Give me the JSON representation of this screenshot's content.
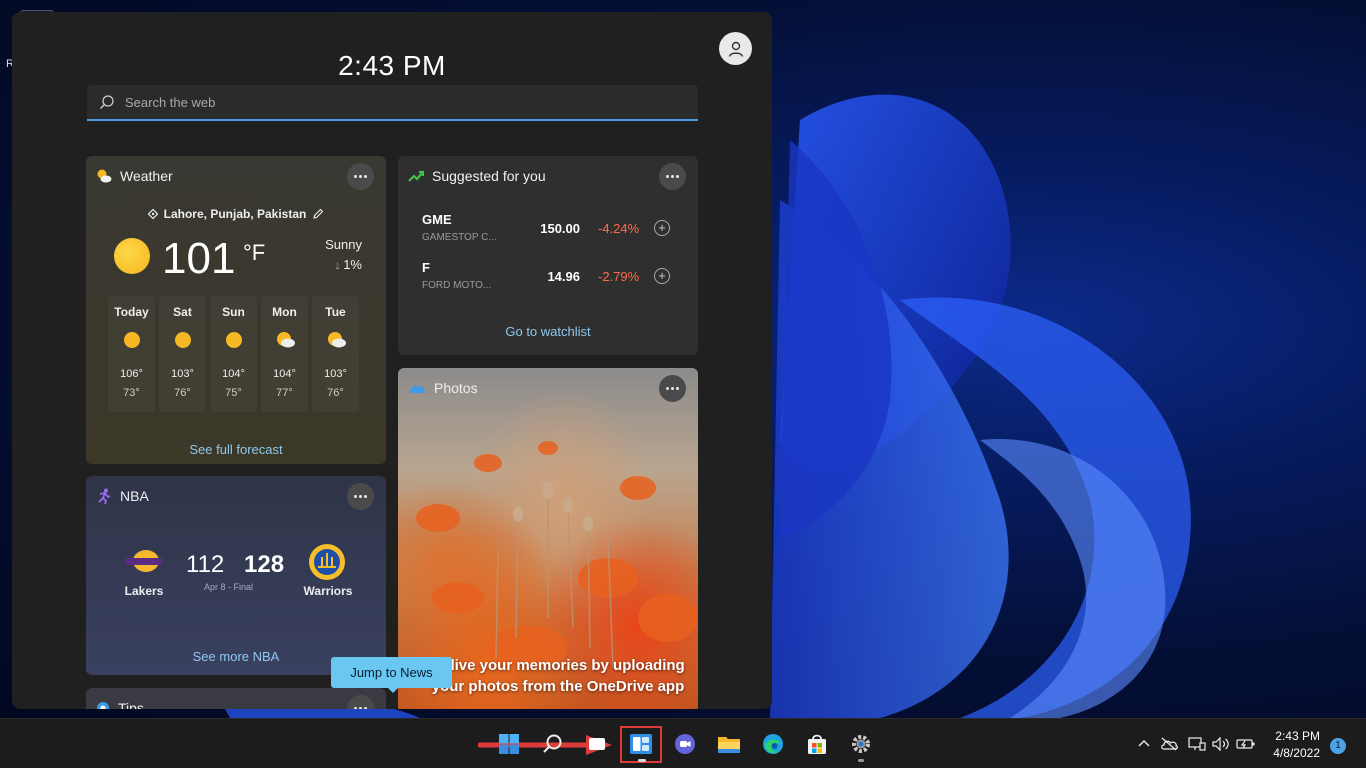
{
  "desktop": {
    "truncated_label": "R"
  },
  "widgets": {
    "time": "2:43 PM",
    "search_placeholder": "Search the web",
    "weather": {
      "title": "Weather",
      "location": "Lahore, Punjab, Pakistan",
      "temp": "101",
      "unit": "°F",
      "condition": "Sunny",
      "precip": "1%",
      "days": [
        {
          "name": "Today",
          "icon": "sun-icon",
          "hi": "106°",
          "lo": "73°"
        },
        {
          "name": "Sat",
          "icon": "sun-icon",
          "hi": "103°",
          "lo": "76°"
        },
        {
          "name": "Sun",
          "icon": "sun-icon",
          "hi": "104°",
          "lo": "75°"
        },
        {
          "name": "Mon",
          "icon": "partly-cloudy-icon",
          "hi": "104°",
          "lo": "77°"
        },
        {
          "name": "Tue",
          "icon": "partly-cloudy-icon",
          "hi": "103°",
          "lo": "76°"
        }
      ],
      "forecast_link": "See full forecast"
    },
    "stocks": {
      "title": "Suggested for you",
      "items": [
        {
          "symbol": "GME",
          "name": "GAMESTOP C...",
          "price": "150.00",
          "change": "-4.24%"
        },
        {
          "symbol": "F",
          "name": "FORD MOTO...",
          "price": "14.96",
          "change": "-2.79%"
        }
      ],
      "watchlist_link": "Go to watchlist"
    },
    "photos": {
      "title": "Photos",
      "caption": "Relive your memories by uploading your photos from the OneDrive app"
    },
    "nba": {
      "title": "NBA",
      "home_team": "Lakers",
      "home_score": "112",
      "away_team": "Warriors",
      "away_score": "128",
      "game_info": "Apr 8 - Final",
      "more_link": "See more NBA"
    },
    "tips": {
      "title": "Tips"
    },
    "tooltip": "Jump to News"
  },
  "taskbar": {
    "time": "2:43 PM",
    "date": "4/8/2022",
    "notification_count": "1",
    "colors": {
      "highlight": "#e03b3b",
      "accent": "#4c9be8"
    }
  }
}
